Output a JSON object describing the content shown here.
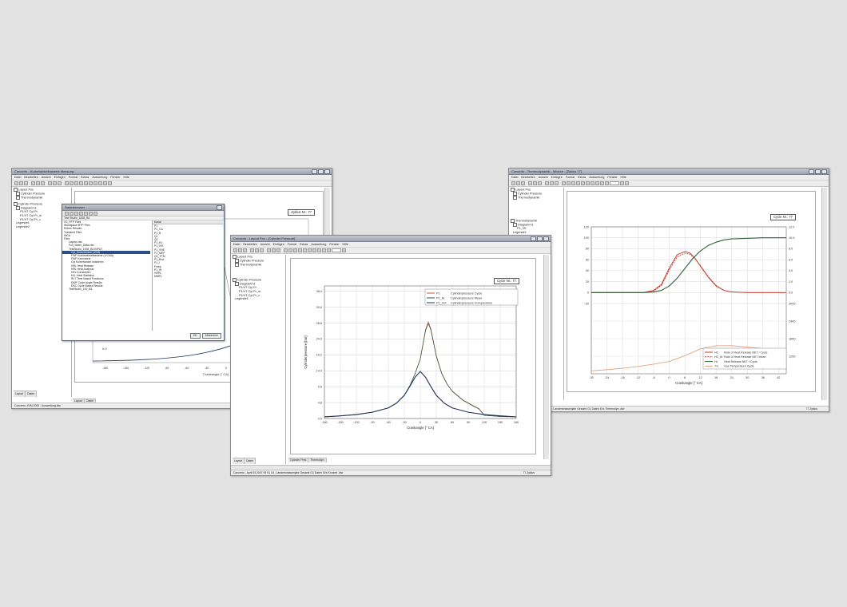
{
  "colors": {
    "background": "#e3e3e3",
    "series_cycle": "#c9574a",
    "series_mean": "#2a5d3c",
    "series_compression": "#1e2f5a",
    "heat_release": "#c0392b",
    "mass_fraction": "#2f5e3a",
    "gas_temp": "#e0a080"
  },
  "left_window": {
    "title": "Concerto - Kurbelwinkelbasierte Messung",
    "menu": [
      "Datei",
      "Bearbeiten",
      "Ansicht",
      "Einfügen",
      "Format",
      "Extras",
      "Auswertung",
      "Fenster",
      "Hilfe"
    ],
    "tree": [
      "Layout Pos",
      "Cylinder Pressure",
      "Thermodynamik",
      "Cylinder Pressure",
      "Diagramm1",
      "P1/VT Cyl Pr",
      "P1/VT Cyl Pr_m",
      "P1/VT Cyl Pr_c",
      "Legende1",
      "Legende2"
    ],
    "tabs": [
      "Layout",
      "Daten"
    ],
    "cycle_label": "Zyklus Nr.: 77",
    "xlabel": "Crankangle [° CA]",
    "status": "Concerto: 4VM 2006 - Auswertung.dlw",
    "dialog": {
      "title": "Datenbrowser",
      "path": "Test Studio_1008_B4",
      "tree": [
        "XS_RTP Files",
        "Workspace RTP Files",
        "Rohes Results",
        "Transient Files",
        "INCA",
        "Files",
        "Layout.xlsx",
        "Full_Slider_Data.xlsx",
        "TestStudio_1008_B4 INPUT",
        "Cyl_Kurbelwinkel (4VM)",
        "FWF Kurbelwinkelbasierte (1/CMA)",
        "FWF Kennwerte",
        "Cyl Kurbelwinkel Indizieren",
        "HRL Heat Release",
        "HRL Heat Analysis",
        "HKL Konstanten",
        "HLL Heat Statistics",
        "RLT Time Based Functions",
        "DWF Cycle Angle Results",
        "DSC Cycle Based Results",
        "TestStudio_100_B4"
      ],
      "col_head": "Kanal",
      "channels": [
        "P1",
        "P1_CA",
        "P1_B",
        "Q1",
        "Q2",
        "P1_EV",
        "P1_IVE",
        "P1_VNE",
        "P1_MEP",
        "Q1_TPM",
        "P1_Rnd",
        "P1_I",
        "Fmep",
        "P1_W",
        "HHPL",
        "MMPL"
      ],
      "buttons": [
        "OK",
        "Abbrechen"
      ]
    }
  },
  "center_window": {
    "title": "Concerto - Layout Pos - [Cylinder Pressure]",
    "menu": [
      "Datei",
      "Bearbeiten",
      "Ansicht",
      "Einfügen",
      "Format",
      "Extras",
      "Auswertung",
      "Fenster",
      "Hilfe"
    ],
    "tree": [
      "Layout Pos",
      "Cylinder Pressure",
      "Thermodynamik",
      "Cylinder Pressure",
      "Diagramm1",
      "P1/VT Cyl Pr",
      "P1/VT Cyl Pr_m",
      "P1/VT Cyl Pr_c",
      "Legende1"
    ],
    "tabs": [
      "Layout",
      "Daten"
    ],
    "bottom_tabs": [
      "Cylinder Pres",
      "Thermodyn"
    ],
    "cycle_label": "Cycle Nr.: 77",
    "status": "Concerto - April 05 2007 09 51 15 : Landerstrassenjahr Gesamt G1 Daten 4Vs Konzert .dlw",
    "status_right": "77  Zyklus"
  },
  "right_window": {
    "title": "Concerto - Thermodynamik - Mixture - [Zyklus 77]",
    "menu": [
      "Datei",
      "Bearbeiten",
      "Ansicht",
      "Einfügen",
      "Format",
      "Extras",
      "Auswertung",
      "Fenster",
      "Hilfe"
    ],
    "tree": [
      "Layout Pos",
      "Cylinder Pressure",
      "Thermodynamik",
      "Thermodynamik",
      "Diagramm1",
      "P1_VE",
      "Legende1"
    ],
    "tabs": [
      "Cylinder Pres",
      "Thermodyn"
    ],
    "cycle_label": "Cycle Nr.: 77",
    "xlabel": "Crankangle [° CA]",
    "status": "Concerto: April 05 2007 09 51 15 : Landerstrassenjahr Gesamt G1 Daten 4Vs Thermodyn .dlw",
    "status_right": "77  Zyklus"
  },
  "chart_data": [
    {
      "type": "line",
      "title": "",
      "xlabel": "Crankangle [° CA]",
      "ylabel": "Cylinderpressure [bar]",
      "xlim": [
        -180,
        180
      ],
      "ylim": [
        0,
        40
      ],
      "xticks": [
        -180,
        -150,
        -120,
        -90,
        -60,
        -30,
        0,
        30,
        60,
        90,
        120,
        150,
        180
      ],
      "yticks": [
        "0.0",
        "4.8",
        "9.6",
        "14.4",
        "19.2",
        "24.0",
        "28.8",
        "33.6",
        "38.4"
      ],
      "ytick_values": [
        0,
        4.8,
        9.6,
        14.4,
        19.2,
        24.0,
        28.8,
        33.6,
        38.4
      ],
      "legend_position": "top-right",
      "series": [
        {
          "code": "P1",
          "name": "Cylinderpressure Cycle",
          "x": [
            -180,
            -150,
            -120,
            -90,
            -60,
            -45,
            -30,
            -20,
            -10,
            0,
            5,
            10,
            15,
            20,
            25,
            30,
            40,
            50,
            60,
            80,
            100,
            110,
            120,
            150,
            180
          ],
          "y": [
            0.5,
            0.8,
            1.2,
            1.9,
            3.2,
            4.6,
            7.0,
            9.8,
            13.4,
            18.0,
            22.5,
            27.0,
            29.2,
            27.0,
            23.0,
            19.0,
            13.8,
            10.5,
            8.3,
            5.6,
            3.8,
            3.0,
            1.0,
            0.6,
            0.5
          ]
        },
        {
          "code": "P1_M",
          "name": "Cylinderpressure Mean",
          "x": [
            -180,
            -150,
            -120,
            -90,
            -60,
            -45,
            -30,
            -20,
            -10,
            0,
            5,
            10,
            15,
            20,
            25,
            30,
            40,
            50,
            60,
            80,
            100,
            110,
            120,
            150,
            180
          ],
          "y": [
            0.5,
            0.8,
            1.2,
            1.9,
            3.2,
            4.6,
            7.0,
            9.8,
            13.4,
            18.0,
            22.3,
            26.6,
            28.7,
            26.6,
            22.7,
            18.8,
            13.6,
            10.4,
            8.2,
            5.5,
            3.7,
            2.9,
            1.0,
            0.6,
            0.5
          ]
        },
        {
          "code": "P1_CO",
          "name": "Cylinderpressure Compression",
          "x": [
            -180,
            -150,
            -120,
            -90,
            -60,
            -45,
            -30,
            -20,
            -10,
            0,
            10,
            20,
            30,
            45,
            60,
            90,
            120,
            150,
            180
          ],
          "y": [
            0.5,
            0.8,
            1.2,
            1.9,
            3.2,
            4.6,
            7.0,
            9.6,
            12.4,
            14.2,
            12.4,
            9.6,
            7.0,
            4.6,
            3.2,
            1.9,
            1.2,
            0.8,
            0.5
          ]
        }
      ]
    },
    {
      "type": "line",
      "title": "",
      "xlabel": "Crankangle [° CA]",
      "xlim": [
        -30,
        45
      ],
      "xticks": [
        -30,
        -24,
        -18,
        -12,
        -6,
        0,
        6,
        12,
        18,
        24,
        30,
        36,
        42
      ],
      "y_left_ticks": [
        "120",
        "100",
        "80",
        "60",
        "40",
        "20",
        "0",
        "-20"
      ],
      "y_right_upper_ticks": [
        "12.0",
        "10.0",
        "8.0",
        "6.0",
        "4.0",
        "2.0",
        "0.0"
      ],
      "y_right_lower_ticks": [
        "3000",
        "2400",
        "1800",
        "1200"
      ],
      "legend_position": "bottom-right",
      "series": [
        {
          "code": "HC",
          "name": "Rate of Heat Release NET / Cycle",
          "x": [
            -30,
            -10,
            -6,
            -3,
            0,
            3,
            6,
            8,
            10,
            12,
            15,
            18,
            21,
            24,
            30,
            45
          ],
          "y": [
            0,
            0,
            0.4,
            1.5,
            4.5,
            6.9,
            7.5,
            7.2,
            6.2,
            4.8,
            2.8,
            1.2,
            0.4,
            0.1,
            0,
            0
          ]
        },
        {
          "code": "HC_M",
          "name": "Rate of Heat Release NET Mean",
          "x": [
            -30,
            -10,
            -6,
            -3,
            0,
            3,
            6,
            8,
            10,
            12,
            15,
            18,
            21,
            24,
            30,
            45
          ],
          "y": [
            0,
            0,
            0.3,
            1.3,
            4.1,
            6.5,
            7.2,
            7.0,
            6.1,
            4.9,
            2.9,
            1.3,
            0.4,
            0.1,
            0,
            0
          ]
        },
        {
          "code": "HL",
          "name": "Heat Release NET / Cycle",
          "x": [
            -30,
            -10,
            -6,
            -3,
            0,
            3,
            6,
            9,
            12,
            15,
            18,
            21,
            24,
            30,
            36,
            42,
            45
          ],
          "y": [
            0,
            0,
            1,
            4,
            12,
            26,
            44,
            62,
            76,
            86,
            92,
            96,
            98,
            99,
            100,
            100,
            100
          ]
        },
        {
          "code": "TG",
          "name": "Gas Temperature Cycle",
          "x": [
            -30,
            -24,
            -18,
            -12,
            -6,
            0,
            6,
            12,
            18,
            24,
            30,
            36,
            42,
            45
          ],
          "y": [
            700,
            740,
            790,
            850,
            930,
            1020,
            1220,
            1450,
            1560,
            1560,
            1510,
            1460,
            1410,
            1390
          ]
        }
      ]
    }
  ]
}
